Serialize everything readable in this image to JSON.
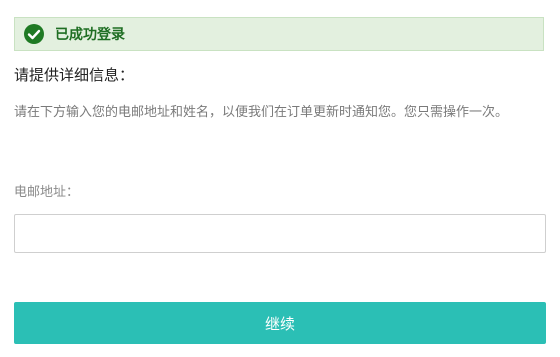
{
  "banner": {
    "icon": "check-circle-icon",
    "message": "已成功登录",
    "color": "#1f6e23",
    "background": "#e3f0df"
  },
  "form": {
    "title": "请提供详细信息：",
    "description": "请在下方输入您的电邮地址和姓名，以便我们在订单更新时通知您。您只需操作一次。",
    "email_label": "电邮地址：",
    "email_value": "",
    "continue_label": "继续",
    "button_color": "#2bbfb5"
  }
}
